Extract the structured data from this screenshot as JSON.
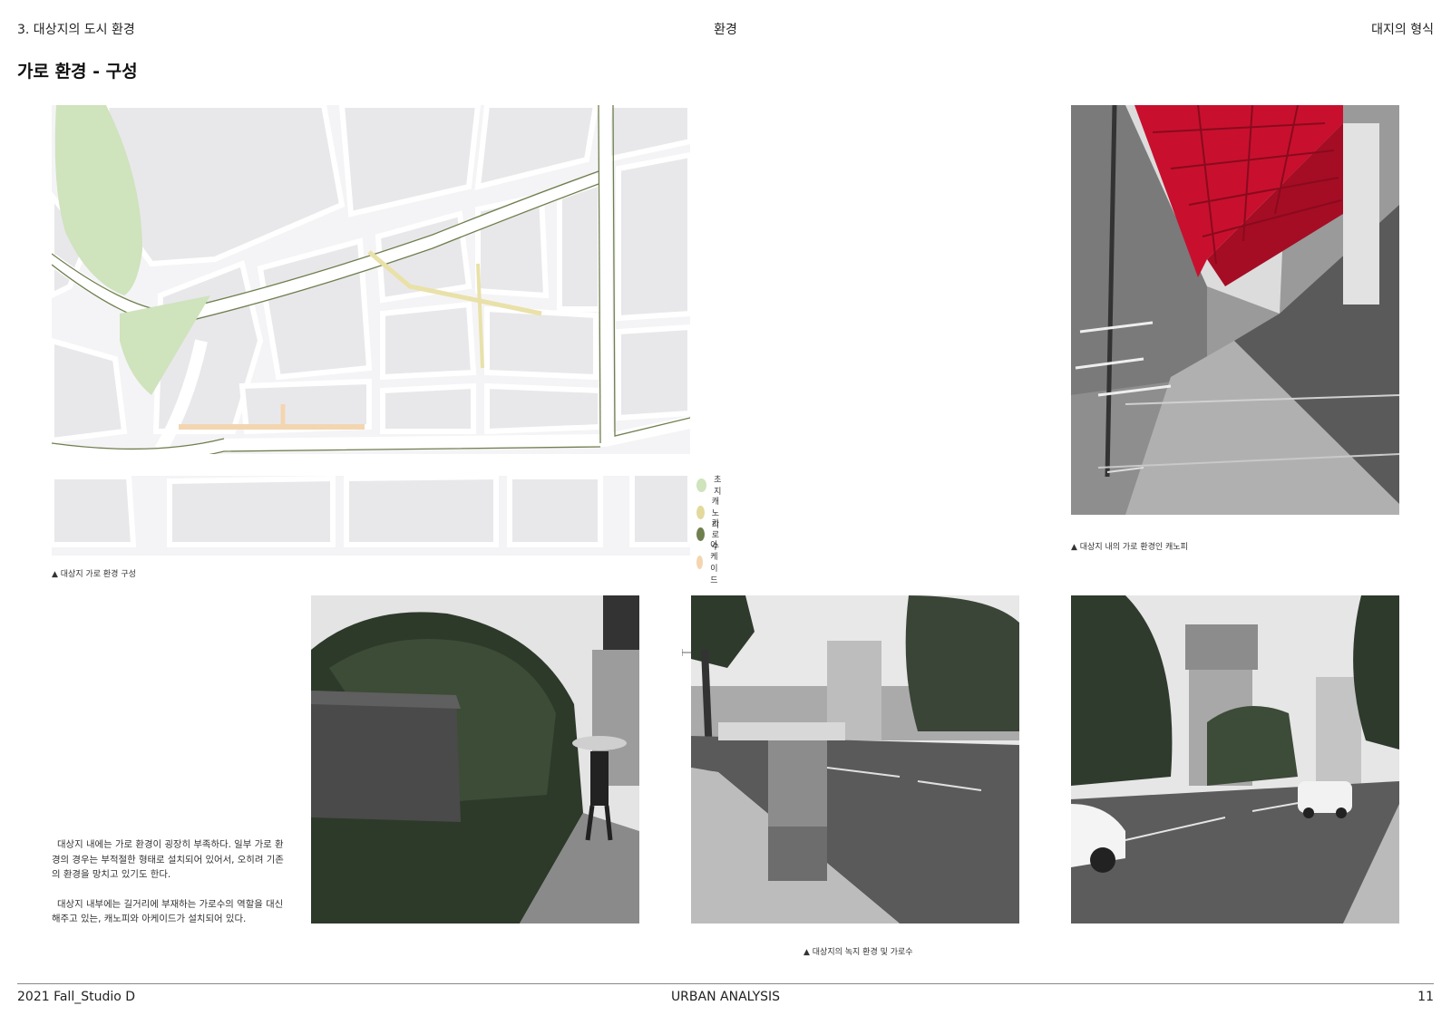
{
  "header": {
    "section": "3. 대상지의 도시 환경",
    "center": "환경",
    "right": "대지의 형식"
  },
  "page_title": "가로 환경 - 구성",
  "map": {
    "legend": [
      {
        "label": "초지",
        "color": "#cfe3bd"
      },
      {
        "label": "캐노피",
        "color": "#e2d99c"
      },
      {
        "label": "가로수",
        "color": "#6f7f4e"
      },
      {
        "label": "아케이드",
        "color": "#f3d6b0"
      }
    ],
    "caption": "▲ 대상지 가로 환경 구성"
  },
  "photos": {
    "canopy_caption": "▲ 대상지 내의 가로 환경인 캐노피",
    "green_caption": "▲ 대상지의 녹지 환경 및 가로수"
  },
  "body": {
    "paragraph1": "대상지 내에는 가로 환경이 굉장히 부족하다. 일부 가로 환경의 경우는 부적절한 형태로 설치되어 있어서, 오히려 기존의 환경을 망치고 있기도 한다.",
    "paragraph2": "대상지 내부에는 길거리에 부재하는 가로수의 역할을 대신 해주고 있는, 캐노피와 아케이드가 설치되어 있다."
  },
  "footer": {
    "left": "2021 Fall_Studio D",
    "center": "URBAN ANALYSIS",
    "page_number": "11"
  },
  "colors": {
    "accent_canopy_red": "#c8102e",
    "block_grey": "#e9e9ec",
    "street_line": "#6f7f4e"
  }
}
